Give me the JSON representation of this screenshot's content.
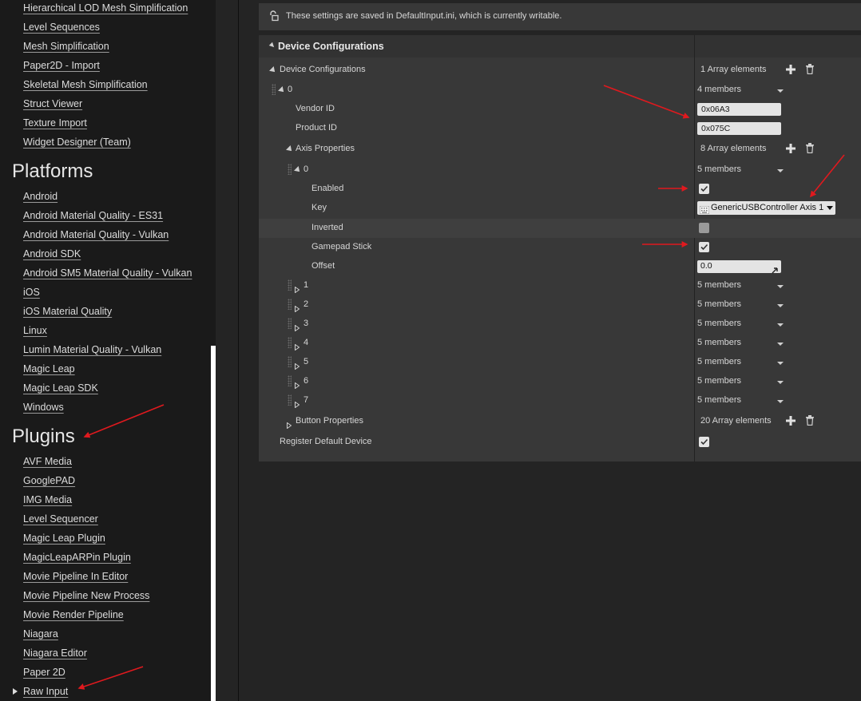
{
  "sidebar": {
    "top_links": [
      "Hierarchical LOD Mesh Simplification",
      "Level Sequences",
      "Mesh Simplification",
      "Paper2D - Import",
      "Skeletal Mesh Simplification",
      "Struct Viewer",
      "Texture Import",
      "Widget Designer (Team)"
    ],
    "platforms_heading": "Platforms",
    "platforms": [
      "Android",
      "Android Material Quality - ES31",
      "Android Material Quality - Vulkan",
      "Android SDK",
      "Android SM5 Material Quality - Vulkan",
      "iOS",
      "iOS Material Quality",
      "Linux",
      "Lumin Material Quality - Vulkan",
      "Magic Leap",
      "Magic Leap SDK",
      "Windows"
    ],
    "plugins_heading": "Plugins",
    "plugins": [
      "AVF Media",
      "GooglePAD",
      "IMG Media",
      "Level Sequencer",
      "Magic Leap Plugin",
      "MagicLeapARPin Plugin",
      "Movie Pipeline In Editor",
      "Movie Pipeline New Process",
      "Movie Render Pipeline",
      "Niagara",
      "Niagara Editor",
      "Paper 2D",
      "Raw Input"
    ]
  },
  "notice": {
    "text": "These settings are saved in DefaultInput.ini, which is currently writable.",
    "icon": "unlock-icon"
  },
  "section": {
    "title": "Device Configurations"
  },
  "rows": {
    "device_configs": {
      "label": "Device Configurations",
      "value": "1 Array elements"
    },
    "element0": {
      "label": "0",
      "value": "4 members"
    },
    "vendor": {
      "label": "Vendor ID",
      "value": "0x06A3"
    },
    "product": {
      "label": "Product ID",
      "value": "0x075C"
    },
    "axis_props": {
      "label": "Axis Properties",
      "value": "8 Array elements"
    },
    "axis0": {
      "label": "0",
      "value": "5 members"
    },
    "enabled": {
      "label": "Enabled",
      "checked": true
    },
    "key": {
      "label": "Key",
      "value": "GenericUSBController Axis 1"
    },
    "inverted": {
      "label": "Inverted",
      "checked": false
    },
    "gamepad": {
      "label": "Gamepad Stick",
      "checked": true
    },
    "offset": {
      "label": "Offset",
      "value": "0.0"
    },
    "axes": [
      {
        "label": "1",
        "value": "5 members"
      },
      {
        "label": "2",
        "value": "5 members"
      },
      {
        "label": "3",
        "value": "5 members"
      },
      {
        "label": "4",
        "value": "5 members"
      },
      {
        "label": "5",
        "value": "5 members"
      },
      {
        "label": "6",
        "value": "5 members"
      },
      {
        "label": "7",
        "value": "5 members"
      }
    ],
    "button_props": {
      "label": "Button Properties",
      "value": "20 Array elements"
    },
    "register": {
      "label": "Register Default Device",
      "checked": true
    }
  },
  "colors": {
    "annotation_arrow": "#e0191e",
    "panel_bg": "#383838",
    "page_bg": "#1a1a1a"
  }
}
